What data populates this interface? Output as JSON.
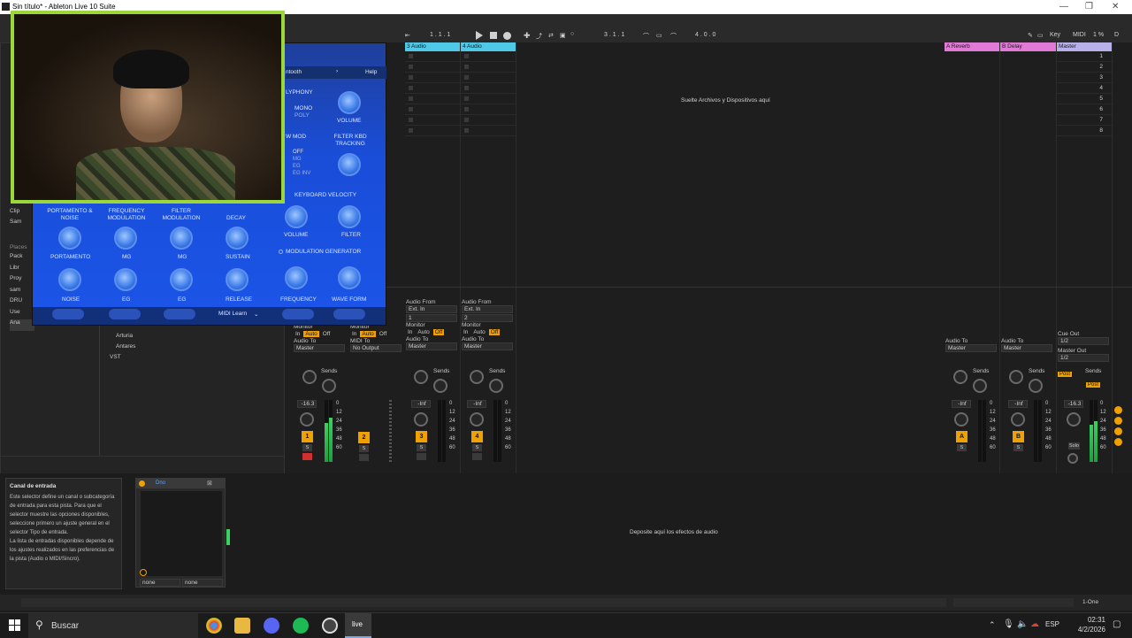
{
  "window": {
    "title": "Sin título* - Ableton Live 10 Suite",
    "min_glyph": "—",
    "max_glyph": "❐",
    "close_glyph": "✕"
  },
  "control_bar": {
    "pos1": "1 .  1 .  1",
    "pos2": "3 .  1 .  1",
    "loop_len": "4 .  0 .  0",
    "key": "Key",
    "midi": "MIDI",
    "cpu": "1 %",
    "d": "D"
  },
  "session": {
    "tracks": [
      {
        "name": "3 Audio",
        "color": "#4ec9e8"
      },
      {
        "name": "4 Audio",
        "color": "#4ec9e8"
      }
    ],
    "returns": [
      {
        "name": "A Reverb",
        "color": "#e07ad6"
      },
      {
        "name": "B Delay",
        "color": "#e07ad6"
      }
    ],
    "master": {
      "name": "Master",
      "color": "#b8b0e8"
    },
    "scenes": [
      "1",
      "2",
      "3",
      "4",
      "5",
      "6",
      "7",
      "8"
    ],
    "drop_hint": "Suelte Archivos y Dispositivos aquí"
  },
  "mixer": {
    "audio_from": "Audio From",
    "ext_in": "Ext. In",
    "in1": "1",
    "in2": "2",
    "monitor": "Monitor",
    "in": "In",
    "auto": "Auto",
    "off": "Off",
    "audio_to": "Audio To",
    "midi_to": "MIDI To",
    "master": "Master",
    "no_output": "No Output",
    "sends": "Sends",
    "send_a": "A",
    "send_b": "B",
    "cue_out": "Cue Out",
    "master_out": "Master Out",
    "half": "1/2",
    "post": "Post",
    "vol_t1": "-16.3",
    "vol_inf": "-Inf",
    "vol_master": "-16.3",
    "scale": [
      "0",
      "12",
      "24",
      "36",
      "48",
      "60"
    ],
    "track_nums": [
      "1",
      "2",
      "3",
      "4"
    ],
    "return_letters": [
      "A",
      "B"
    ],
    "s": "S",
    "solo": "Solo"
  },
  "browser": {
    "items": [
      "Clip",
      "Sam"
    ],
    "places_label": "Places",
    "places": [
      "Pack",
      "Libr",
      "Proy",
      "sam",
      "DRU",
      "Use",
      "Ana"
    ],
    "tree": [
      "Arturia",
      "Antares",
      "VST"
    ]
  },
  "plugin": {
    "menu_label": "ntooth",
    "help": "Help",
    "polyphony": "LYPHONY",
    "mono": "MONO",
    "poly": "POLY",
    "volume": "VOLUME",
    "w_mod": "W MOD",
    "filter_kbd": "FILTER KBD TRACKING",
    "off": "OFF",
    "mg": "MG",
    "eg": "EG",
    "eg_inv": "EG INV",
    "keyboard_velocity": "KEYBOARD VELOCITY",
    "filter": "FILTER",
    "modulation_generator": "MODULATION GENERATOR",
    "frequency": "FREQUENCY",
    "wave_form": "WAVE FORM",
    "sec_portamento": "PORTAMENTO & NOISE",
    "sec_freqmod": "FREQUENCY MODULATION",
    "sec_filtermod": "FILTER MODULATION",
    "decay": "DECAY",
    "portamento": "PORTAMENTO",
    "sustain": "SUSTAIN",
    "noise": "NOISE",
    "release": "RELEASE",
    "midi_learn": "MIDI Learn"
  },
  "info": {
    "title": "Canal de entrada",
    "body": "Este selector define un canal o subcategoría de entrada para esta pista. Para que el selector muestre las opciones disponibles, seleccione primero un ajuste general en el selector Tipo de entrada.",
    "body2": "La lista de entradas disponibles depende de los ajustes realizados en las preferencias de la pista (Audio o MIDI/Sincro)."
  },
  "device": {
    "name": "Dno",
    "none1": "none",
    "none2": "none"
  },
  "drop_effects": "Deposite aquí los efectos de audio",
  "status": {
    "right": "1-One"
  },
  "taskbar": {
    "search": "Buscar",
    "lang": "ESP",
    "time": "02:31",
    "date": "4/2/2026",
    "live": "live"
  }
}
